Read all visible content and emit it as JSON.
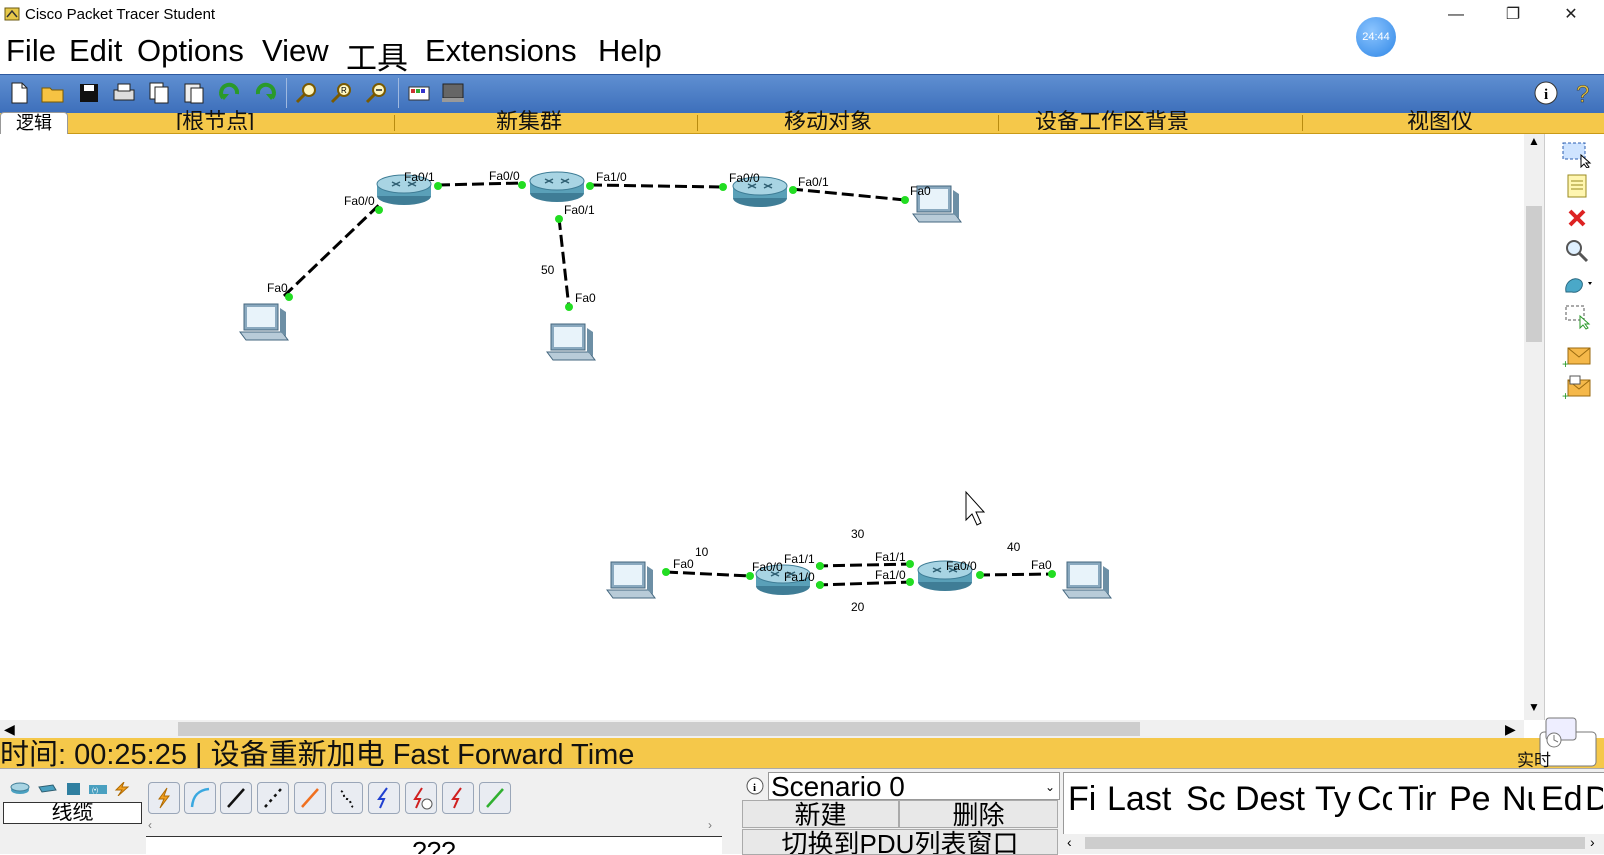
{
  "window": {
    "title": "Cisco Packet Tracer Student",
    "clock_badge": "24:44",
    "minimize_glyph": "—",
    "restore_glyph": "❐",
    "close_glyph": "✕"
  },
  "menu": [
    "File",
    "Edit",
    "Options",
    "View",
    "工具",
    "Extensions",
    "Help"
  ],
  "toolbar": {
    "buttons": [
      "new-file-icon",
      "open-folder-icon",
      "save-icon",
      "print-icon",
      "copy-icon",
      "paste-icon",
      "undo-icon",
      "redo-icon",
      "zoom-in-icon",
      "zoom-reset-icon",
      "zoom-out-icon",
      "palette-icon",
      "custom-device-icon"
    ],
    "right": [
      "info-icon",
      "help-icon"
    ]
  },
  "tabstrip": {
    "logic_tab": "逻辑",
    "items": [
      "[根节点]",
      "新集群",
      "移动对象",
      "设备工作区背景",
      "视图仪"
    ]
  },
  "topology": {
    "labels": {
      "r1_fa01": "Fa0/1",
      "r1_fa00": "Fa0/0",
      "r2_fa00": "Fa0/0",
      "r2_fa10": "Fa1/0",
      "r2_fa01": "Fa0/1",
      "r3_fa00": "Fa0/0",
      "r3_fa01": "Fa0/1",
      "pc1_fa0": "Fa0",
      "pc2_fa0": "Fa0",
      "pc3_fa0": "Fa0",
      "link50": "50",
      "pc4_fa0": "Fa0",
      "r4_fa00": "Fa0/0",
      "r4_fa11": "Fa1/1",
      "r4_fa10": "Fa1/0",
      "r5_fa11": "Fa1/1",
      "r5_fa10": "Fa1/0",
      "r5_fa00": "Fa0/0",
      "pc5_fa0": "Fa0",
      "link10": "10",
      "link30": "30",
      "link20": "20",
      "link40": "40"
    }
  },
  "rightbar": [
    "select-icon",
    "note-icon",
    "delete-icon",
    "inspect-icon",
    "draw-shape-icon",
    "resize-icon",
    "add-simple-pdu-icon",
    "add-complex-pdu-icon"
  ],
  "status": {
    "text": "时间: 00:25:25 | 设备重新加电  Fast Forward Time",
    "mode": "实时"
  },
  "bottom": {
    "category_label": "线缆",
    "cable_label": "???",
    "scenario": "Scenario 0",
    "new_button": "新建",
    "delete_button": "删除",
    "pdu_window_button": "切换到PDU列表窗口",
    "pdu_columns": [
      "Fi",
      "Last",
      "Sc",
      "Dest",
      "Ty",
      "Co",
      "Tir",
      "Pe",
      "Nu",
      "Ed",
      "D"
    ]
  }
}
